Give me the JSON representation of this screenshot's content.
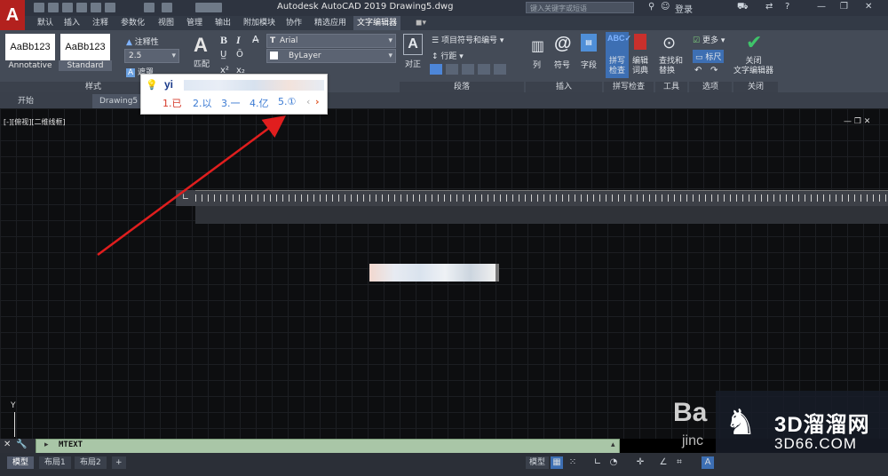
{
  "titlebar": {
    "app_title": "Autodesk AutoCAD 2019    Drawing5.dwg",
    "search_placeholder": "键入关键字或短语",
    "login_label": "登录",
    "app_logo": "A"
  },
  "ribbon_tabs": [
    "默认",
    "插入",
    "注释",
    "参数化",
    "视图",
    "管理",
    "输出",
    "附加模块",
    "协作",
    "精选应用",
    "文字编辑器"
  ],
  "active_tab": "文字编辑器",
  "ribbon": {
    "styles": {
      "style1_preview": "AaBb123",
      "style1_name": "Annotative",
      "style2_preview": "AaBb123",
      "style2_name": "Standard",
      "annotative_label": "注释性",
      "height_value": "2.5",
      "mask_label": "遮罩",
      "panel_label": "样式"
    },
    "format": {
      "match_label": "匹配",
      "bold": "B",
      "italic": "I",
      "font_value": "Arial",
      "color_value": "ByLayer"
    },
    "paragraph": {
      "align_label": "对正",
      "bullets_label": "项目符号和编号",
      "linespacing_label": "行距",
      "panel_label": "段落"
    },
    "insert": {
      "column_label": "列",
      "symbol_label": "符号",
      "field_label": "字段",
      "panel_label": "插入"
    },
    "spell": {
      "spellcheck_label": "拼写\n检查",
      "edit_dict_label": "编辑\n词典",
      "panel_label": "拼写检查"
    },
    "tools": {
      "find_replace_label": "查找和\n替换",
      "panel_label": "工具"
    },
    "options": {
      "more_label": "更多",
      "ruler_label": "标尺",
      "panel_label": "选项"
    },
    "close": {
      "close_label": "关闭\n文字编辑器",
      "panel_label": "关闭"
    }
  },
  "ime": {
    "input": "yi",
    "candidates": [
      "1.已",
      "2.以",
      "3.一",
      "4.亿",
      "5.①"
    ]
  },
  "doc_tabs": [
    "开始",
    "Drawing5"
  ],
  "viewport_label": "[-][俯视][二维线框]",
  "command_line": "MTEXT",
  "layout_tabs": [
    "模型",
    "布局1",
    "布局2"
  ],
  "status": {
    "model_label": "模型"
  },
  "watermark": {
    "brand1": "3D溜溜网",
    "brand2": "3D66.COM",
    "baidu1": "Ba",
    "baidu2": "jinc"
  },
  "colors": {
    "arrow": "#e01e1e",
    "logo": "#b3211e"
  }
}
